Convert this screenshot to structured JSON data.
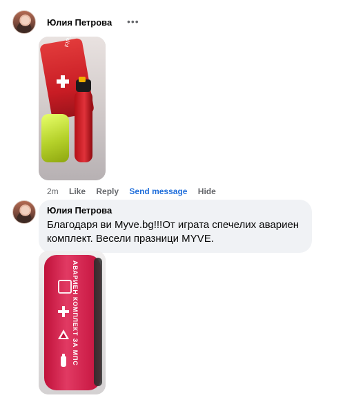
{
  "post": {
    "author": "Юлия Петрова",
    "more_icon": "ellipsis-icon",
    "actions": {
      "time": "2m",
      "like": "Like",
      "reply": "Reply",
      "send_message": "Send message",
      "hide": "Hide"
    }
  },
  "comment": {
    "author": "Юлия Петрова",
    "text": "Благодаря ви Myve.bg!!!От играта спечелих авариен комплект. Весели празници MYVE."
  },
  "images": {
    "kit1_label": "FIRST AID KIT",
    "kit2_label": "АВАРИЕН КОМПЛЕКТ ЗА МПС"
  },
  "colors": {
    "link": "#216fdb",
    "muted": "#65676b",
    "bubble_bg": "#f0f2f5"
  }
}
